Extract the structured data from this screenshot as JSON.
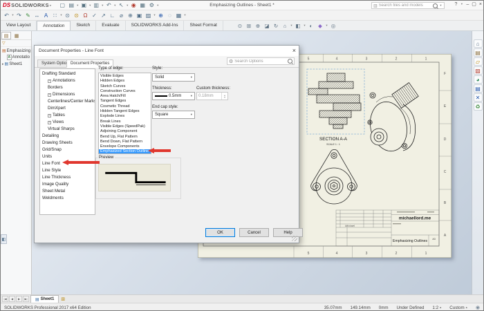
{
  "brand": {
    "logo_ds": "DS",
    "logo_text": "SOLIDWORKS"
  },
  "window": {
    "title": "Emphasizing Outlines - Sheet1 *",
    "search_placeholder": "Search files and models",
    "help_label": "?",
    "minimize_label": "–",
    "restore_label": "▢",
    "close_label": "×"
  },
  "titlebar_icons": [
    {
      "name": "new-document-icon",
      "glyph": "▢"
    },
    {
      "name": "open-icon",
      "glyph": "▤",
      "caret": true
    },
    {
      "name": "save-icon",
      "glyph": "▣",
      "caret": true
    },
    {
      "name": "print-icon",
      "glyph": "▥",
      "caret": true
    },
    {
      "name": "undo-icon",
      "glyph": "↶",
      "caret": true
    },
    {
      "name": "select-icon",
      "glyph": "↖",
      "caret": true
    },
    {
      "name": "selection-filter-icon",
      "glyph": "◉",
      "color": "#b23b2e"
    },
    {
      "name": "rebuild-icon",
      "glyph": "▦"
    },
    {
      "name": "options-icon",
      "glyph": "⚙",
      "caret": true
    }
  ],
  "toolbar_icons": [
    {
      "name": "undo-icon",
      "glyph": "↶",
      "caret": true
    },
    {
      "name": "redo-icon",
      "glyph": "↷"
    },
    {
      "name": "format-painter-icon",
      "glyph": "✎",
      "color": "#3a8a3a"
    },
    {
      "name": "smart-dimension-icon",
      "glyph": "↔"
    },
    {
      "name": "note-icon",
      "glyph": "A",
      "color": "#2255aa"
    },
    {
      "name": "linear-pattern-icon",
      "glyph": "∷",
      "caret": true
    },
    {
      "name": "zoom-previous-icon",
      "glyph": "⊙"
    },
    {
      "name": "zoom-area-icon",
      "glyph": "⊙",
      "color": "#b8860b"
    },
    {
      "name": "balloon-icon",
      "glyph": "Ω",
      "color": "#b23b2e"
    },
    {
      "name": "spell-check-icon",
      "glyph": "✓"
    },
    {
      "name": "leader-icon",
      "glyph": "↗"
    },
    {
      "name": "weld-symbol-icon",
      "glyph": "∟"
    },
    {
      "name": "hole-callout-icon",
      "glyph": "⌀"
    },
    {
      "name": "geometric-tolerance-icon",
      "glyph": "⊕"
    },
    {
      "name": "datum-feature-icon",
      "glyph": "▣"
    },
    {
      "name": "area-hatch-icon",
      "glyph": "▨",
      "caret": true
    },
    {
      "name": "center-mark-icon",
      "glyph": "⊕",
      "color": "#2255aa"
    },
    {
      "name": "revision-cloud-icon",
      "glyph": "◌"
    },
    {
      "name": "table-icon",
      "glyph": "▦",
      "caret": true
    }
  ],
  "ribbon_tabs": [
    {
      "label": "View Layout",
      "active": false
    },
    {
      "label": "Annotation",
      "active": true
    },
    {
      "label": "Sketch",
      "active": false
    },
    {
      "label": "Evaluate",
      "active": false
    },
    {
      "label": "SOLIDWORKS Add-Ins",
      "active": false
    },
    {
      "label": "Sheet Format",
      "active": false
    }
  ],
  "headsup_icons": [
    {
      "name": "zoom-fit-icon",
      "glyph": "⊙"
    },
    {
      "name": "zoom-area-icon",
      "glyph": "⊞"
    },
    {
      "name": "zoom-in-out-icon",
      "glyph": "⊕"
    },
    {
      "name": "section-view-icon",
      "glyph": "◪"
    },
    {
      "name": "rotate-view-icon",
      "glyph": "↻"
    },
    {
      "name": "view-orientation-icon",
      "glyph": "⌂",
      "caret": true
    },
    {
      "name": "display-style-icon",
      "glyph": "◧",
      "caret": true
    },
    {
      "name": "hide-show-items-icon",
      "glyph": "◐"
    },
    {
      "name": "edit-appearance-icon",
      "glyph": "◆",
      "color": "#8c6bc8",
      "caret": true
    },
    {
      "name": "view-settings-icon",
      "glyph": "◎"
    }
  ],
  "taskpane_icons": [
    {
      "name": "solidworks-resources-icon",
      "glyph": "⌂"
    },
    {
      "name": "design-library-icon",
      "glyph": "▤",
      "color": "#8a6d3b"
    },
    {
      "name": "file-explorer-icon",
      "glyph": "▱",
      "color": "#b8860b"
    },
    {
      "name": "view-palette-icon",
      "glyph": "▨",
      "color": "#b23b2e"
    },
    {
      "name": "appearances-scenes-icon",
      "glyph": "◕",
      "color": "#2e8b57"
    },
    {
      "name": "custom-properties-icon",
      "glyph": "▤",
      "color": "#2255aa"
    },
    {
      "name": "solidworks-forum-icon",
      "glyph": "✕",
      "color": "#2255aa"
    },
    {
      "name": "recycle-icon",
      "glyph": "♻",
      "color": "#3a8a3a"
    }
  ],
  "feature_tree": {
    "root": "Emphasizing",
    "items": [
      "Annotatio",
      "Sheet1"
    ]
  },
  "dialog": {
    "title": "Document Properties - Line Font",
    "tabs": [
      {
        "label": "System Options",
        "active": false
      },
      {
        "label": "Document Properties",
        "active": true
      }
    ],
    "search_placeholder": "Search Options",
    "tree": [
      {
        "label": "Drafting Standard",
        "indent": 0
      },
      {
        "label": "Annotations",
        "indent": 1,
        "expand": true
      },
      {
        "label": "Borders",
        "indent": 1
      },
      {
        "label": "Dimensions",
        "indent": 1,
        "expand": true
      },
      {
        "label": "Centerlines/Center Marks",
        "indent": 1
      },
      {
        "label": "DimXpert",
        "indent": 1
      },
      {
        "label": "Tables",
        "indent": 1,
        "expand": true
      },
      {
        "label": "Views",
        "indent": 1,
        "expand": true
      },
      {
        "label": "Virtual Sharps",
        "indent": 1
      },
      {
        "label": "Detailing",
        "indent": 0
      },
      {
        "label": "Drawing Sheets",
        "indent": 0
      },
      {
        "label": "Grid/Snap",
        "indent": 0
      },
      {
        "label": "Units",
        "indent": 0
      },
      {
        "label": "Line Font",
        "indent": 0
      },
      {
        "label": "Line Style",
        "indent": 0
      },
      {
        "label": "Line Thickness",
        "indent": 0
      },
      {
        "label": "Image Quality",
        "indent": 0
      },
      {
        "label": "Sheet Metal",
        "indent": 0
      },
      {
        "label": "Weldments",
        "indent": 0
      }
    ],
    "type_of_edge_label": "Type of edge:",
    "edge_types": [
      "Visible Edges",
      "Hidden Edges",
      "Sketch Curves",
      "Construction Curves",
      "Area Hatch/Fill",
      "Tangent Edges",
      "Cosmetic Thread",
      "Hidden Tangent Edges",
      "Explode Lines",
      "Break Lines",
      "Visible Edges (SpeedPak)",
      "Adjoining Component",
      "Bend Up, Flat Pattern",
      "Bend Down, Flat Pattern",
      "Envelope Components",
      "Emphasized Section Outline"
    ],
    "selected_edge_index": 15,
    "style": {
      "label": "Style:",
      "value": "Solid"
    },
    "thickness": {
      "label": "Thickness:",
      "value": "0.5mm"
    },
    "custom_thickness": {
      "label": "Custom thickness:",
      "value": "0.18mm"
    },
    "end_cap": {
      "label": "End cap style:",
      "value": "Square"
    },
    "preview_label": "Preview",
    "ok_label": "OK",
    "cancel_label": "Cancel",
    "help_label": "Help"
  },
  "drawing": {
    "section_label": "SECTION A-A",
    "scale_label": "SCALE 1 : 1",
    "website": "michaellord.me",
    "signature": "Michael",
    "sheet_title": "Emphasizing Outlines",
    "paper_size": "A3",
    "zone_columns": [
      "5",
      "4",
      "3",
      "2",
      "1"
    ],
    "zone_rows": [
      "F",
      "E",
      "D",
      "C",
      "B",
      "A"
    ]
  },
  "sheet_tabs": {
    "nav": [
      {
        "name": "first-sheet-icon",
        "glyph": "|◀"
      },
      {
        "name": "previous-sheet-icon",
        "glyph": "◀"
      },
      {
        "name": "next-sheet-icon",
        "glyph": "▶"
      },
      {
        "name": "last-sheet-icon",
        "glyph": "▶|"
      }
    ],
    "active": "Sheet1"
  },
  "statusbar": {
    "left": "SOLIDWORKS Professional 2017 x64 Edition",
    "x": "35.07mm",
    "y": "149.14mm",
    "z": "0mm",
    "state": "Under Defined",
    "scale": "1:2",
    "units": "Custom"
  },
  "colors": {
    "selection": "#3297fd",
    "arrow_red": "#e0372e",
    "sheet": "#f1f0e3",
    "accent": "#0078d7"
  }
}
